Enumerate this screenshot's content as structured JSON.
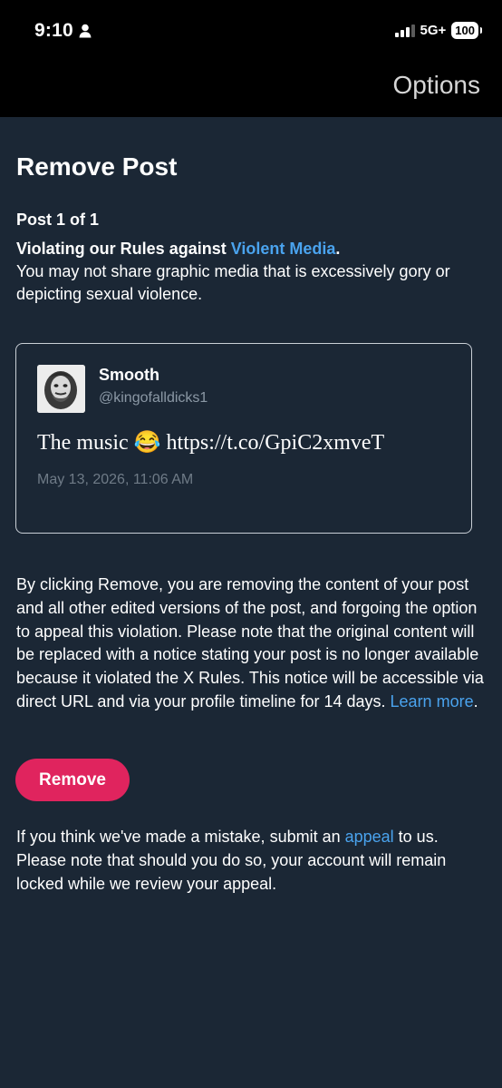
{
  "status_bar": {
    "time": "9:10",
    "network": "5G+",
    "battery": "100"
  },
  "header": {
    "options_label": "Options"
  },
  "page": {
    "title": "Remove Post",
    "post_count": "Post 1 of 1",
    "violation_prefix": "Violating our Rules against ",
    "violation_rule": "Violent Media",
    "violation_suffix": ".",
    "violation_desc": "You may not share graphic media that is excessively gory or depicting sexual violence."
  },
  "post": {
    "author_name": "Smooth",
    "author_handle": "@kingofalldicks1",
    "text": "The music 😂 https://t.co/GpiC2xmveT",
    "date": "May 13, 2026, 11:06 AM"
  },
  "explanation": {
    "text": "By clicking Remove, you are removing the content of your post and all other edited versions of the post, and forgoing the option to appeal this violation. Please note that the original content will be replaced with a notice stating your post is no longer available because it violated the X Rules. This notice will be accessible via direct URL and via your profile timeline for 14 days. ",
    "learn_more": "Learn more",
    "end": "."
  },
  "actions": {
    "remove_label": "Remove"
  },
  "appeal": {
    "prefix": "If you think we've made a mistake, submit an ",
    "link": "appeal",
    "suffix": " to us. Please note that should you do so, your account will remain locked while we review your appeal."
  },
  "colors": {
    "background": "#1b2735",
    "link": "#4aa3ee",
    "remove_button": "#e0245e"
  },
  "icons": [
    "person-icon",
    "signal-icon",
    "battery-icon"
  ]
}
